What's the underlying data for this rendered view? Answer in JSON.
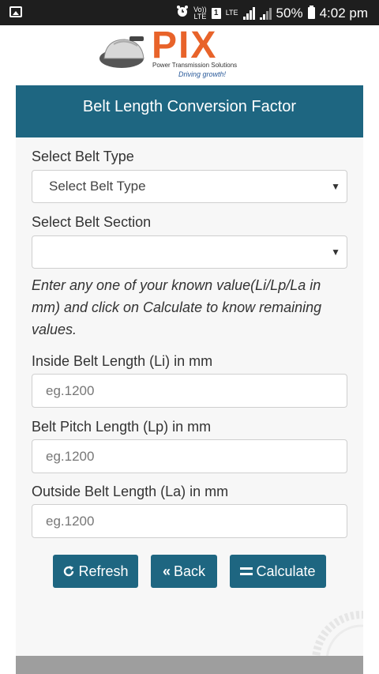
{
  "status_bar": {
    "volte_top": "Vo))",
    "volte_bottom": "LTE",
    "sim": "1",
    "network": "LTE",
    "battery_percent": "50%",
    "time": "4:02 pm"
  },
  "logo": {
    "name": "PIX",
    "tagline": "Power Transmission Solutions",
    "slogan": "Driving growth!"
  },
  "header": {
    "title": "Belt Length Conversion Factor"
  },
  "form": {
    "belt_type_label": "Select Belt Type",
    "belt_type_value": "Select Belt Type",
    "belt_section_label": "Select Belt Section",
    "belt_section_value": "",
    "info_text": "Enter any one of your known value(Li/Lp/La in mm) and click on Calculate to know remaining values.",
    "inside_label": "Inside Belt Length (Li) in mm",
    "inside_placeholder": "eg.1200",
    "pitch_label": "Belt Pitch Length (Lp) in mm",
    "pitch_placeholder": "eg.1200",
    "outside_label": "Outside Belt Length (La) in mm",
    "outside_placeholder": "eg.1200"
  },
  "buttons": {
    "refresh": "Refresh",
    "back": "Back",
    "calculate": "Calculate"
  },
  "icons": {
    "refresh": "refresh-icon",
    "back": "double-chevron-left-icon",
    "calculate": "equals-icon"
  },
  "colors": {
    "primary": "#1e6681",
    "logo_orange": "#e8632a",
    "status_bar": "#1e1e1e"
  }
}
